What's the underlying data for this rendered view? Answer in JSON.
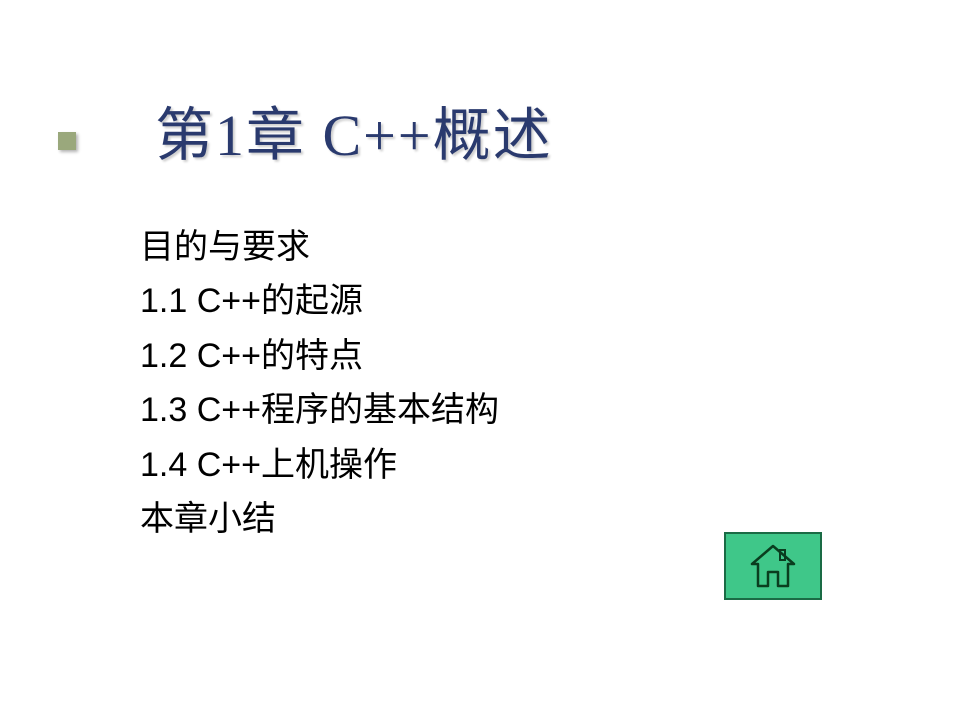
{
  "title": "第1章  C++概述",
  "content": {
    "line0": "目的与要求",
    "line1": "1.1  C++的起源",
    "line2": "1.2  C++的特点",
    "line3": "1.3  C++程序的基本结构",
    "line4": "1.4  C++上机操作",
    "line5": "本章小结"
  },
  "icons": {
    "home": "home-icon"
  }
}
